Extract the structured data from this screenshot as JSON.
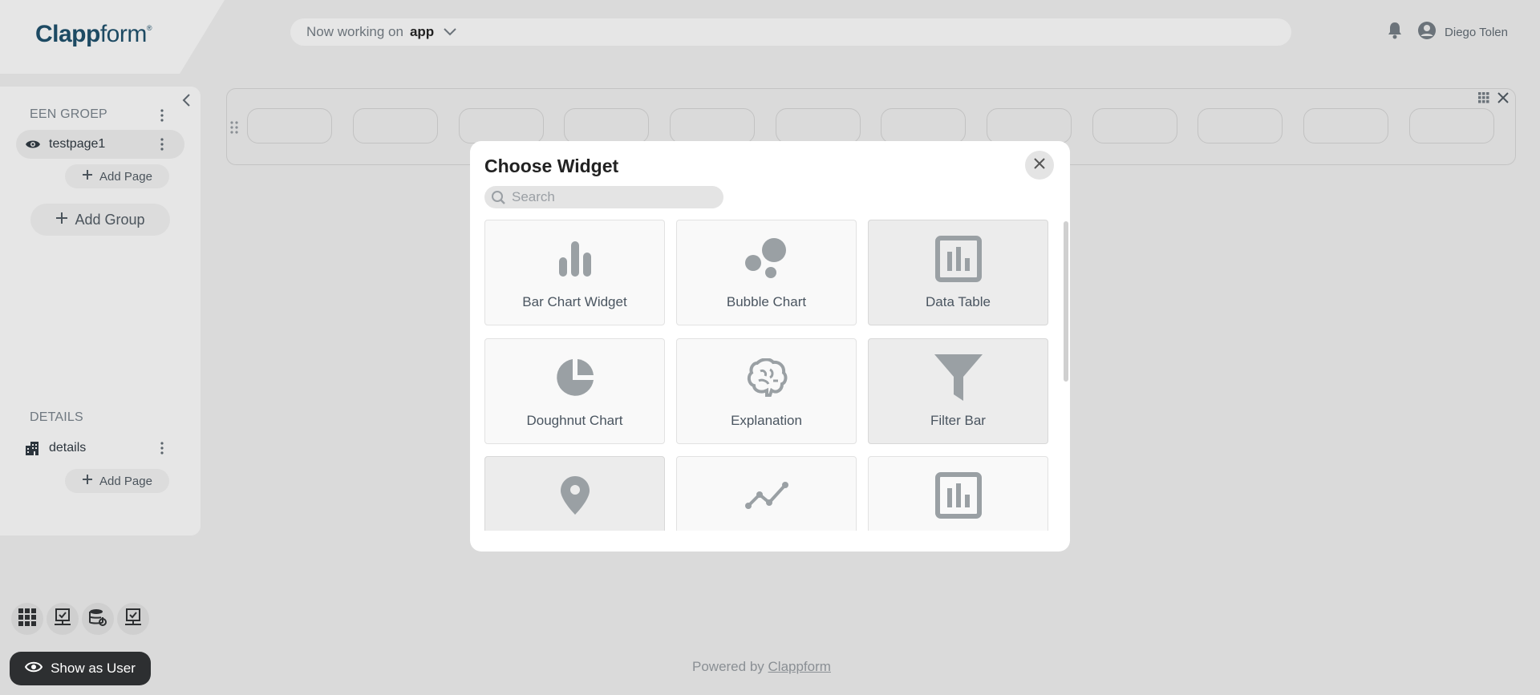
{
  "header": {
    "logo_bold": "Clapp",
    "logo_rest": "form",
    "logo_mark": "®",
    "working_prefix": "Now working on",
    "working_app": "app",
    "user_name": "Diego Tolen"
  },
  "sidebar": {
    "group1": {
      "title": "EEN GROEP",
      "page": "testpage1",
      "add_page": "Add Page"
    },
    "add_group": "Add Group",
    "group2": {
      "title": "DETAILS",
      "page": "details",
      "add_page": "Add Page"
    }
  },
  "bottom": {
    "show_as_user": "Show as User",
    "powered_prefix": "Powered by",
    "powered_brand": "Clappform"
  },
  "modal": {
    "title": "Choose Widget",
    "search_placeholder": "Search",
    "widgets": [
      {
        "label": "Bar Chart Widget",
        "icon": "bar-chart-icon"
      },
      {
        "label": "Bubble Chart",
        "icon": "bubble-chart-icon"
      },
      {
        "label": "Data Table",
        "icon": "data-table-icon"
      },
      {
        "label": "Doughnut Chart",
        "icon": "doughnut-chart-icon"
      },
      {
        "label": "Explanation",
        "icon": "brain-icon"
      },
      {
        "label": "Filter Bar",
        "icon": "funnel-icon"
      },
      {
        "label": "",
        "icon": "map-pin-icon"
      },
      {
        "label": "",
        "icon": "line-chart-icon"
      },
      {
        "label": "",
        "icon": "data-table-icon"
      }
    ]
  },
  "colors": {
    "background": "#dadada",
    "panel": "#e6e6e6",
    "logo": "#1d4a63",
    "icon_gray": "#9aa0a4",
    "dark_button": "#2d2f31"
  }
}
